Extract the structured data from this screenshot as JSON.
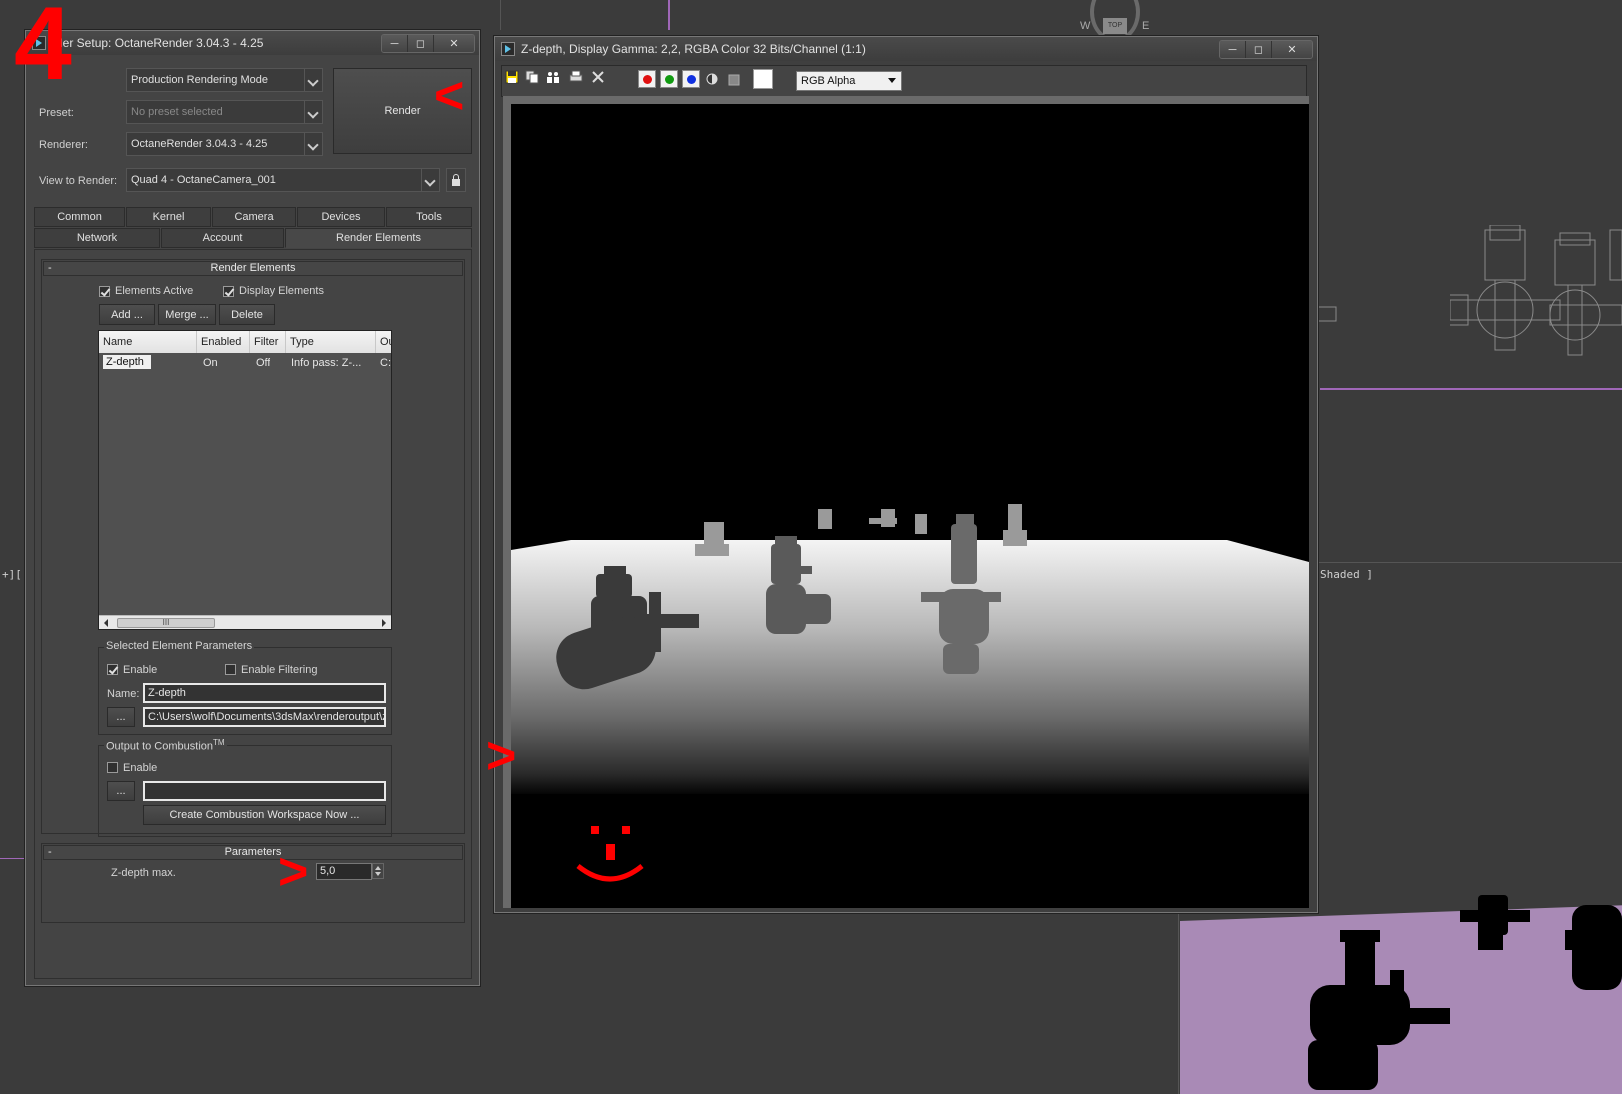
{
  "step_number": "4",
  "viewport": {
    "label_left": "+][",
    "label_shaded": "Shaded ]",
    "viewcube_w": "W",
    "viewcube_top": "TOP",
    "viewcube_e": "E"
  },
  "render_setup": {
    "title": "Render Setup: OctaneRender 3.04.3 - 4.25",
    "title_visible": "der Setup: OctaneRender 3.04.3 - 4.25",
    "mode": "Production Rendering Mode",
    "preset_label": "Preset:",
    "preset_value": "No preset selected",
    "renderer_label": "Renderer:",
    "renderer_value": "OctaneRender 3.04.3 - 4.25",
    "view_label": "View to Render:",
    "view_value": "Quad 4 - OctaneCamera_001",
    "render_button": "Render",
    "tabs_row1": [
      "Common",
      "Kernel",
      "Camera",
      "Devices",
      "Tools"
    ],
    "tabs_row2": [
      "Network",
      "Account",
      "Render Elements"
    ],
    "render_elements": {
      "rollout_title": "Render Elements",
      "elements_active": "Elements Active",
      "display_elements": "Display Elements",
      "add_button": "Add ...",
      "merge_button": "Merge ...",
      "delete_button": "Delete",
      "columns": [
        "Name",
        "Enabled",
        "Filter",
        "Type",
        "Ou"
      ],
      "rows": [
        {
          "name": "Z-depth",
          "enabled": "On",
          "filter": "Off",
          "type": "Info pass: Z-...",
          "output": "C:\\"
        }
      ],
      "scroll_thumb": "III"
    },
    "selected_element": {
      "group_title": "Selected Element Parameters",
      "enable": "Enable",
      "enable_filtering": "Enable Filtering",
      "name_label": "Name:",
      "name_value": "Z-depth",
      "browse_button": "...",
      "path_value": "C:\\Users\\wolf\\Documents\\3dsMax\\renderoutput\\z"
    },
    "combustion": {
      "group_title": "Output to Combustion",
      "tm": "TM",
      "enable": "Enable",
      "browse_button": "...",
      "path_value": "",
      "create_button": "Create Combustion Workspace Now ..."
    },
    "parameters": {
      "rollout_title": "Parameters",
      "zdepth_label": "Z-depth max.",
      "zdepth_value": "5,0"
    }
  },
  "frame_buffer": {
    "title": "Z-depth, Display Gamma: 2,2, RGBA Color 32 Bits/Channel (1:1)",
    "channel_select": "RGB Alpha",
    "colors": {
      "red": "#e01010",
      "green": "#109a10",
      "blue": "#1030e0"
    }
  },
  "annotations": {
    "arrow_render": "<",
    "arrow_canvas": ">",
    "arrow_zdepth": ">",
    "color": "#ff0000"
  }
}
